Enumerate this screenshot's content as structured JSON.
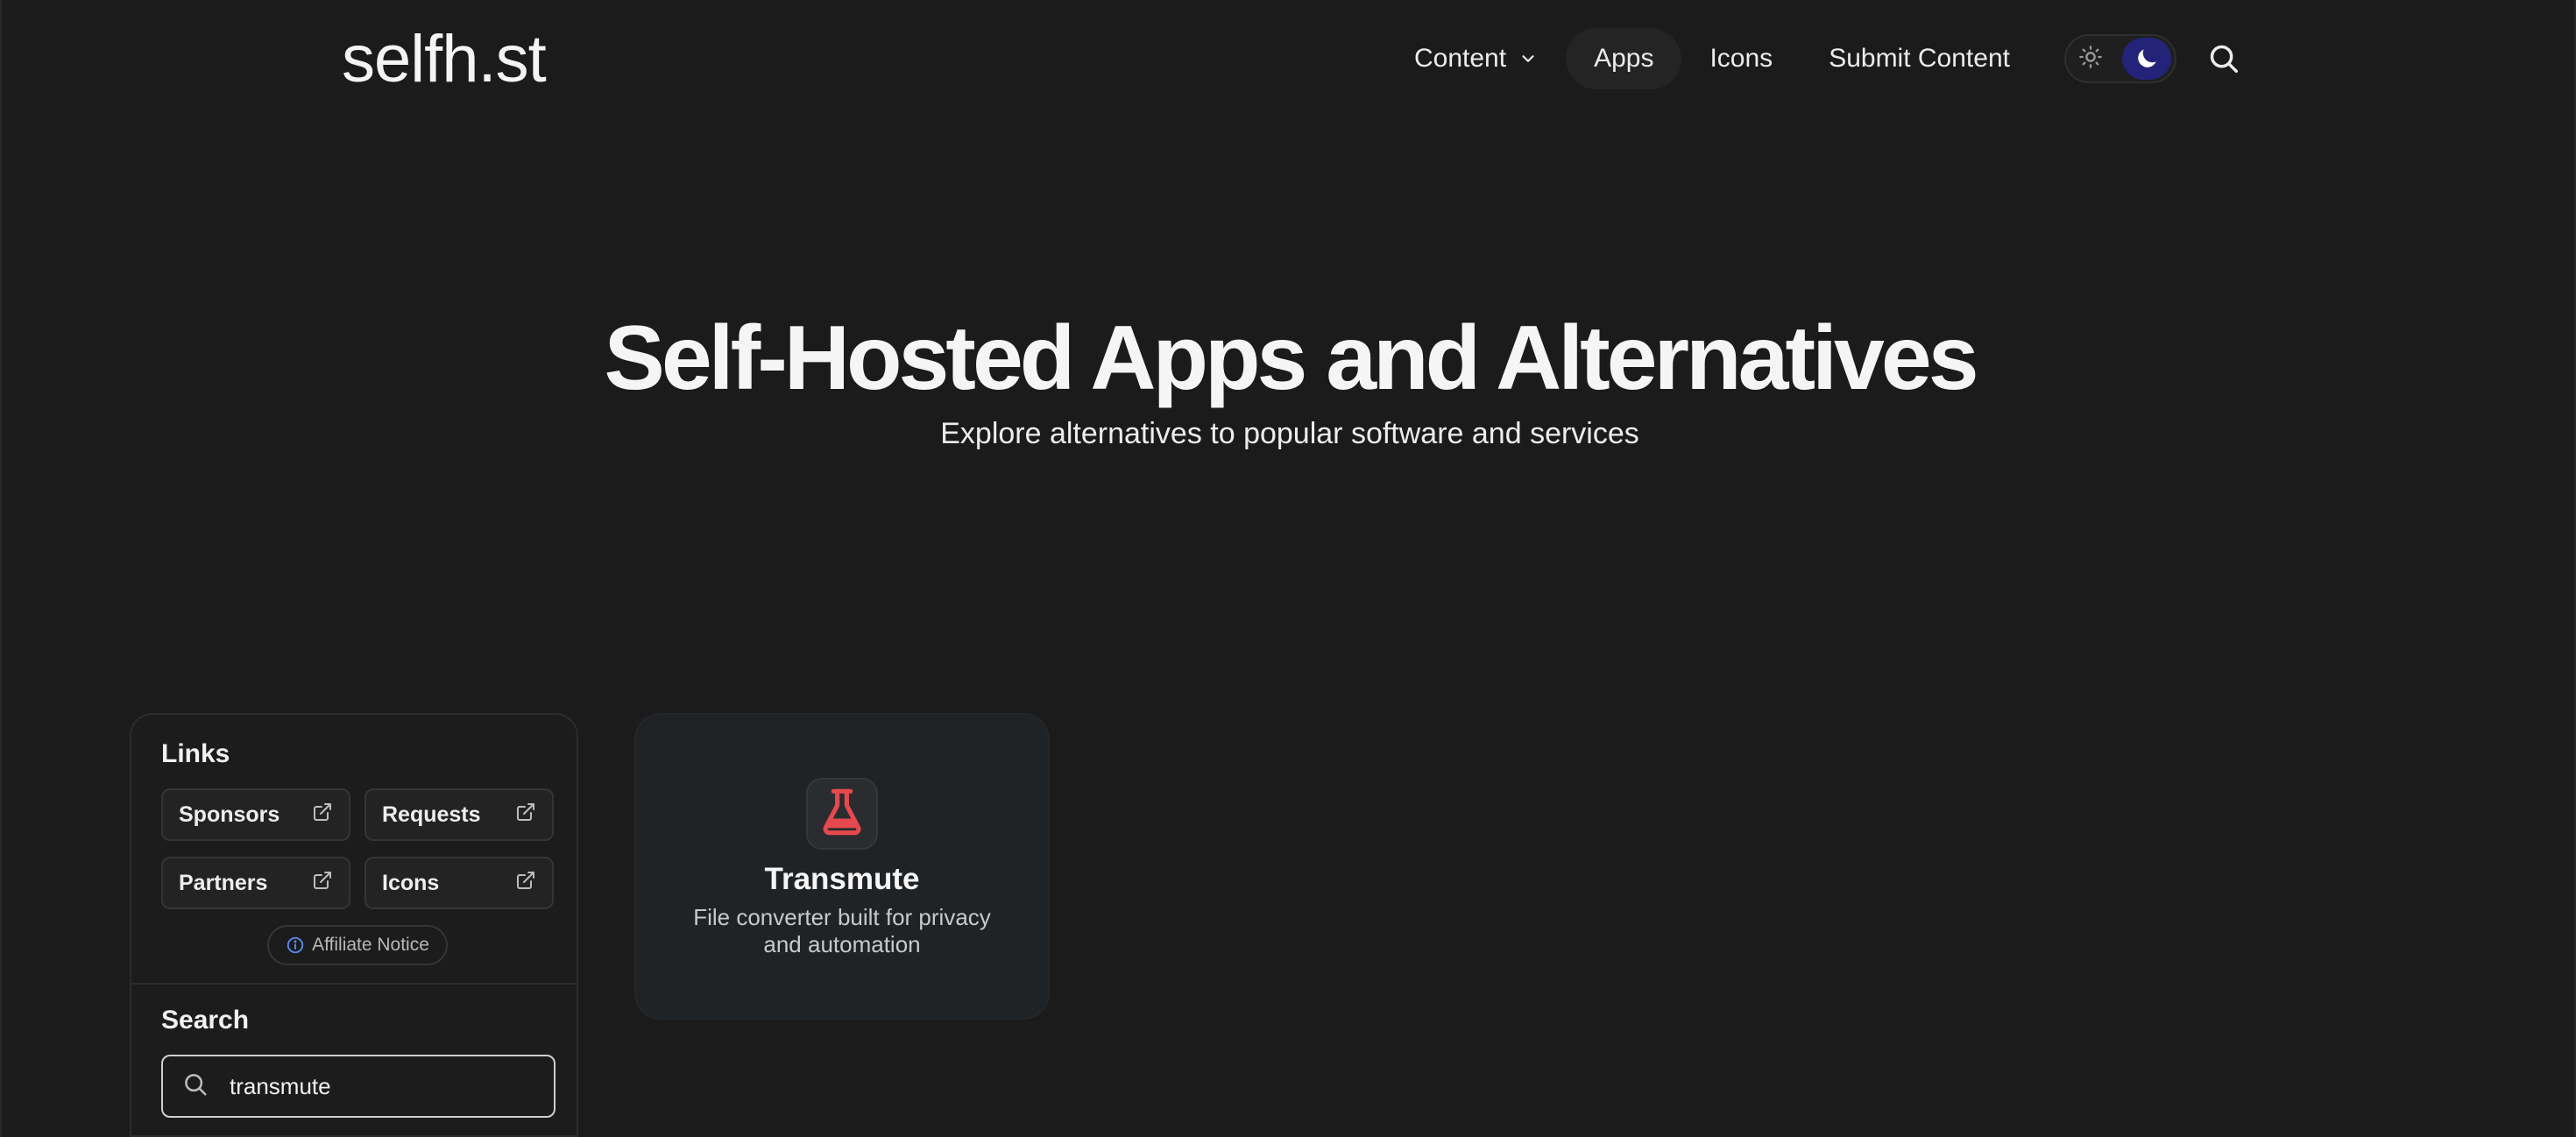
{
  "header": {
    "logo_text": "selfh.st",
    "nav": {
      "content": "Content",
      "apps": "Apps",
      "icons": "Icons",
      "submit": "Submit Content"
    }
  },
  "hero": {
    "title": "Self-Hosted Apps and Alternatives",
    "subtitle": "Explore alternatives to popular software and services"
  },
  "sidebar": {
    "links_heading": "Links",
    "links": {
      "sponsors": "Sponsors",
      "requests": "Requests",
      "partners": "Partners",
      "icons": "Icons"
    },
    "affiliate_notice": "Affiliate Notice",
    "search_heading": "Search",
    "search_value": "transmute"
  },
  "app_card": {
    "name": "Transmute",
    "description": "File converter built for privacy and automation",
    "icon": "flask-icon",
    "icon_color": "#e5484d"
  },
  "colors": {
    "background": "#1b1b1b",
    "card": "#202326",
    "toggle_active": "#23237a"
  }
}
